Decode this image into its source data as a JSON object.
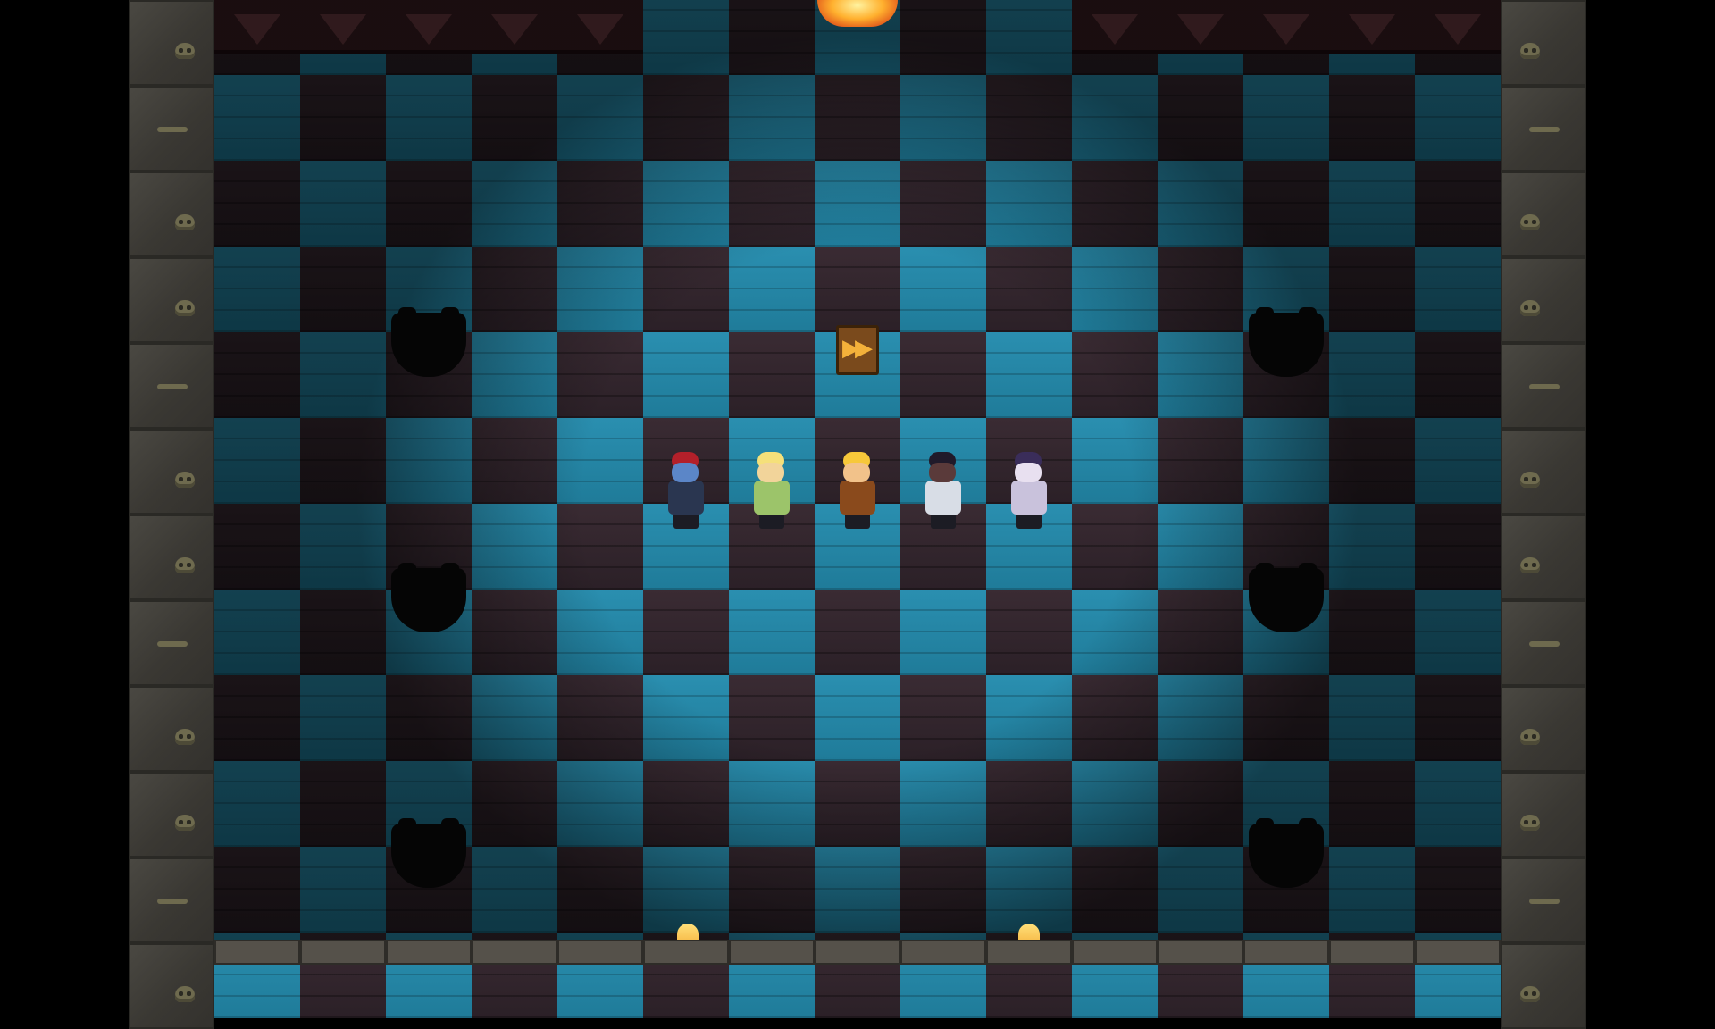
{
  "scene": {
    "type": "dungeon-room",
    "floor_pattern": "checkerboard",
    "colors": {
      "floor_light": "#2a8fb0",
      "floor_dark": "#3a2b33",
      "wall": "#3d3b36",
      "spike_trap": "#3a1d22",
      "fire": "#ffb02e",
      "stairs": "#7a4a1c"
    }
  },
  "objects": {
    "stairs_icon": "exit-stairs-icon",
    "fire_icon": "fire-trap-icon",
    "pit_icon": "pit-hole-icon",
    "spike_icon": "spike-trap-icon"
  },
  "party": [
    {
      "name": "red-hair-hero",
      "head": "#5b86c8",
      "hair": "#b3202a",
      "body": "#2a3650"
    },
    {
      "name": "blonde-cleric-hero",
      "head": "#f2d49a",
      "hair": "#f5e07a",
      "body": "#9cc46a"
    },
    {
      "name": "blonde-fighter-hero",
      "head": "#f2c28a",
      "hair": "#f7c83a",
      "body": "#8a4a1c"
    },
    {
      "name": "dark-hooded-hero",
      "head": "#5a3a3a",
      "hair": "#201a2a",
      "body": "#d8dde6"
    },
    {
      "name": "purple-mage-hero",
      "head": "#e8e0f0",
      "hair": "#3a2d5a",
      "body": "#c9c2dc"
    }
  ]
}
